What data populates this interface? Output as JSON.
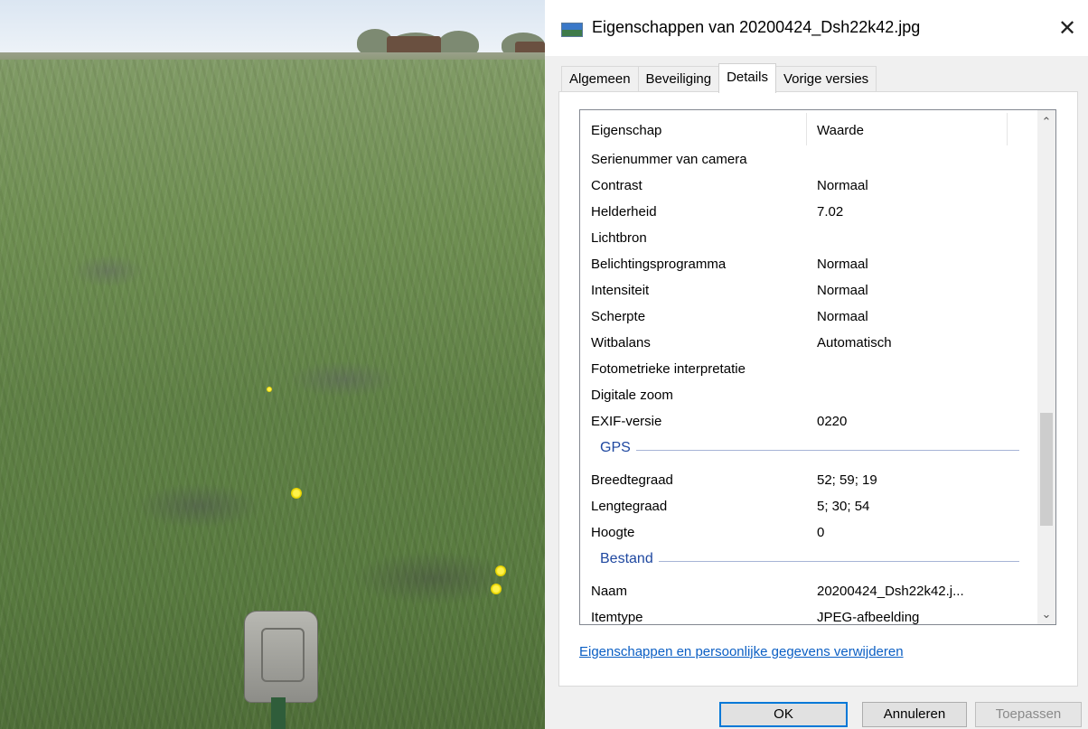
{
  "dialog": {
    "title": "Eigenschappen van 20200424_Dsh22k42.jpg",
    "close_glyph": "✕",
    "tabs": [
      {
        "label": "Algemeen",
        "active": false
      },
      {
        "label": "Beveiliging",
        "active": false
      },
      {
        "label": "Details",
        "active": true
      },
      {
        "label": "Vorige versies",
        "active": false
      }
    ],
    "columns": {
      "property": "Eigenschap",
      "value": "Waarde"
    },
    "rows_top": [
      {
        "property": "Serienummer van camera",
        "value": ""
      },
      {
        "property": "Contrast",
        "value": "Normaal"
      },
      {
        "property": "Helderheid",
        "value": "7.02"
      },
      {
        "property": "Lichtbron",
        "value": ""
      },
      {
        "property": "Belichtingsprogramma",
        "value": "Normaal"
      },
      {
        "property": "Intensiteit",
        "value": "Normaal"
      },
      {
        "property": "Scherpte",
        "value": "Normaal"
      },
      {
        "property": "Witbalans",
        "value": "Automatisch"
      },
      {
        "property": "Fotometrieke interpretatie",
        "value": ""
      },
      {
        "property": "Digitale zoom",
        "value": ""
      },
      {
        "property": "EXIF-versie",
        "value": "0220"
      }
    ],
    "group_gps": {
      "label": "GPS",
      "rows": [
        {
          "property": "Breedtegraad",
          "value": "52; 59; 19"
        },
        {
          "property": "Lengtegraad",
          "value": "5; 30; 54"
        },
        {
          "property": "Hoogte",
          "value": "0"
        }
      ]
    },
    "group_file": {
      "label": "Bestand",
      "rows": [
        {
          "property": "Naam",
          "value": "20200424_Dsh22k42.j..."
        },
        {
          "property": "Itemtype",
          "value": "JPEG-afbeelding"
        }
      ]
    },
    "remove_link": "Eigenschappen en persoonlijke gegevens verwijderen",
    "buttons": {
      "ok": "OK",
      "cancel": "Annuleren",
      "apply": "Toepassen"
    },
    "scroll_up_glyph": "⌃",
    "scroll_down_glyph": "⌄"
  },
  "colors": {
    "link": "#0b5fc4",
    "group_heading": "#1f48a0",
    "default_button_border": "#0078d7",
    "dialog_background": "#f0f0f0"
  }
}
